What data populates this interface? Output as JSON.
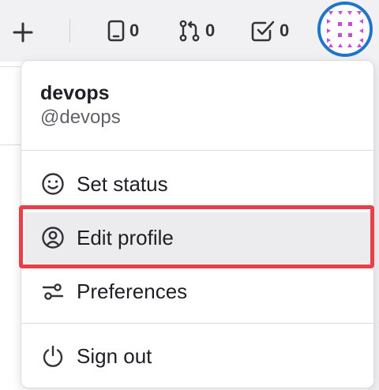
{
  "topbar": {
    "issues_count": "0",
    "merge_requests_count": "0",
    "todos_count": "0"
  },
  "user": {
    "name": "devops",
    "handle": "@devops"
  },
  "menu": {
    "items": [
      {
        "label": "Set status",
        "icon": "smiley-icon"
      },
      {
        "label": "Edit profile",
        "icon": "user-circle-icon"
      },
      {
        "label": "Preferences",
        "icon": "preferences-icon"
      },
      {
        "label": "Sign out",
        "icon": "power-icon"
      }
    ]
  },
  "colors": {
    "highlight": "#e8404a",
    "avatar_ring": "#1f75cb",
    "avatar_pattern": "#c84fd1"
  }
}
